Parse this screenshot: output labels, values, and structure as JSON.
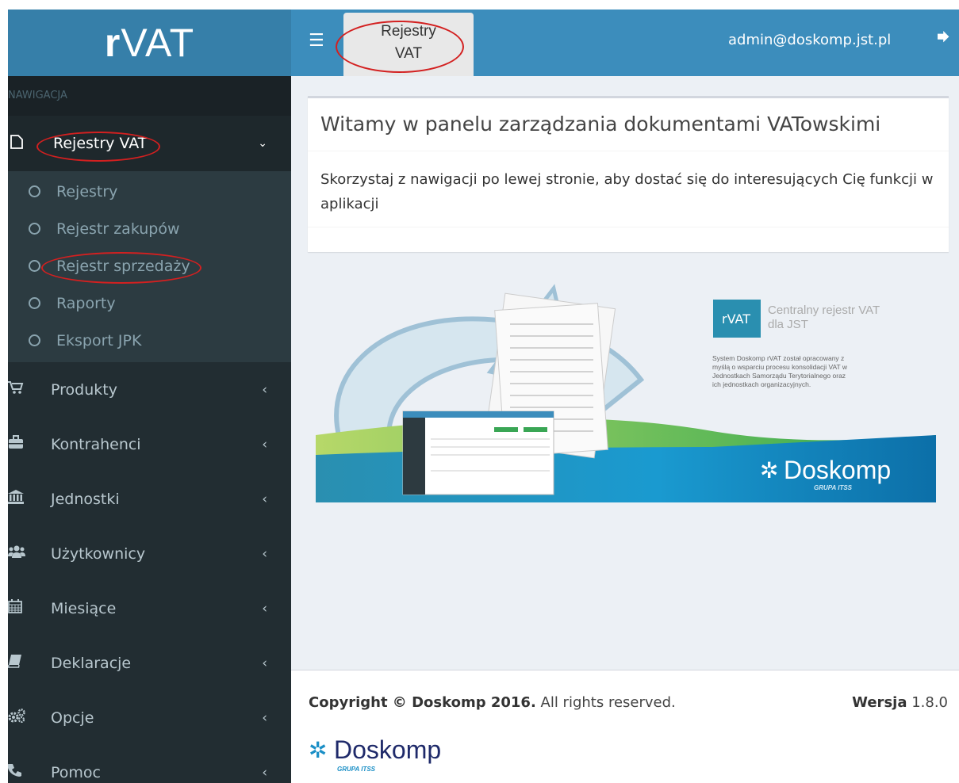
{
  "brand": {
    "logo_r": "r",
    "logo_rest": "VAT"
  },
  "header": {
    "tab_label_line1": "Rejestry",
    "tab_label_line2": "VAT",
    "user_email": "admin@doskomp.jst.pl"
  },
  "sidebar": {
    "section_header": "NAWIGACJA",
    "active_item": {
      "label": "Rejestry VAT",
      "icon": "document-icon"
    },
    "submenu": [
      {
        "label": "Rejestry"
      },
      {
        "label": "Rejestr zakupów"
      },
      {
        "label": "Rejestr sprzedaży"
      },
      {
        "label": "Raporty"
      },
      {
        "label": "Eksport JPK"
      }
    ],
    "items": [
      {
        "label": "Produkty",
        "icon": "cart-icon"
      },
      {
        "label": "Kontrahenci",
        "icon": "briefcase-icon"
      },
      {
        "label": "Jednostki",
        "icon": "institution-icon"
      },
      {
        "label": "Użytkownicy",
        "icon": "users-icon"
      },
      {
        "label": "Miesiące",
        "icon": "calendar-icon"
      },
      {
        "label": "Deklaracje",
        "icon": "book-icon"
      },
      {
        "label": "Opcje",
        "icon": "cogs-icon"
      },
      {
        "label": "Pomoc",
        "icon": "phone-icon"
      }
    ]
  },
  "main": {
    "box_title": "Witamy w panelu zarządzania dokumentami VATowskimi",
    "box_body": "Skorzystaj z nawigacji po lewej stronie, aby dostać się do interesujących Cię funkcji w aplikacji",
    "banner": {
      "logo_label": "rVAT",
      "tagline_line1": "Centralny rejestr VAT",
      "tagline_line2": "dla JST",
      "description_line1": "System Doskomp rVAT został opracowany z",
      "description_line2": "myślą o wsparciu procesu konsolidacji VAT w",
      "description_line3": "Jednostkach Samorządu Terytorialnego oraz",
      "description_line4": "ich jednostkach organizacyjnych.",
      "brand": "Doskomp",
      "brand_sub": "GRUPA ITSS"
    }
  },
  "footer": {
    "copyright_bold": "Copyright © Doskomp 2016.",
    "copyright_rest": " All rights reserved.",
    "version_label": "Wersja",
    "version_value": " 1.8.0",
    "logo_brand": "Doskomp",
    "logo_sub": "GRUPA ITSS"
  },
  "colors": {
    "header": "#3c8dbc",
    "logo_bar": "#367fa9",
    "sidebar": "#222d32",
    "submenu": "#2c3b41",
    "highlight": "#d32020"
  }
}
